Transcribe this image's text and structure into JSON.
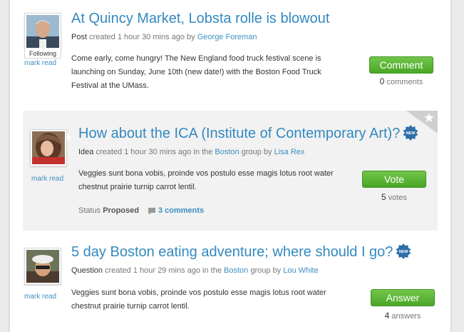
{
  "posts": [
    {
      "title": "At Quincy Market, Lobsta rolle is blowout",
      "type": "Post",
      "meta_created": " created 1 hour 30 mins ago by ",
      "author": "George Foreman",
      "following_label": "Following",
      "mark_read": "mark read",
      "body": "Come early, come hungry! The New England food truck festival scene is launching on Sunday, June 10th (new date!) with the Boston Food Truck Festival at the UMass.",
      "action_label": "Comment",
      "count_num": "0",
      "count_label": " comments"
    },
    {
      "title": "How about the ICA (Institute of Contemporary Art)?",
      "type": "Idea",
      "meta_created": " created 1 hour 30 mins ago in the ",
      "group": "Boston",
      "meta_group_suffix": " group by ",
      "author": "Lisa Rex",
      "mark_read": "mark read",
      "body": "Veggies sunt bona vobis, proinde vos postulo esse magis lotus root water chestnut prairie turnip carrot lentil.",
      "action_label": "Vote",
      "count_num": "5",
      "count_label": " votes",
      "status_label": "Status ",
      "status_value": "Proposed",
      "comments_link": "3 comments",
      "new_badge": "NEW"
    },
    {
      "title": "5 day Boston eating adventure; where should I go?",
      "type": "Question",
      "meta_created": " created 1 hour 29 mins ago in the ",
      "group": "Boston",
      "meta_group_suffix": " group by ",
      "author": "Lou White",
      "mark_read": "mark read",
      "body": "Veggies sunt bona vobis, proinde vos postulo esse magis lotus root water chestnut prairie turnip carrot lentil.",
      "action_label": "Answer",
      "count_num": "4",
      "count_label": " answers",
      "new_badge": "NEW"
    }
  ],
  "colors": {
    "link": "#3389bf",
    "button_green": "#4aa626",
    "featured_bg": "#f2f2f2"
  }
}
